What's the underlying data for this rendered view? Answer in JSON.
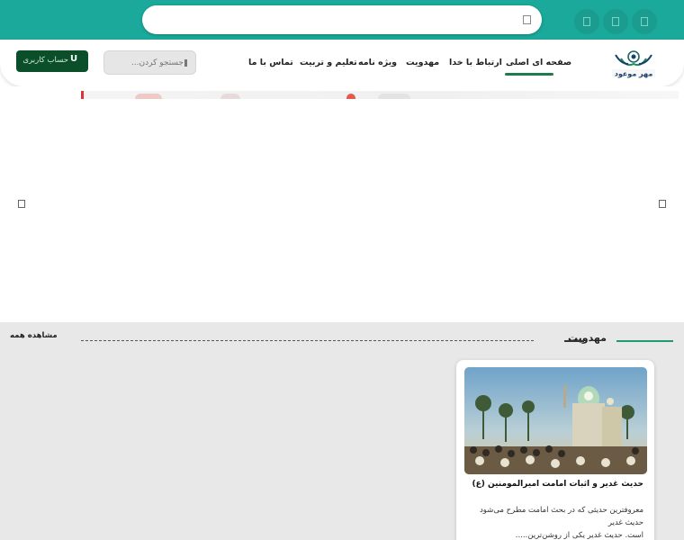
{
  "topbar": {
    "search": {
      "value": "",
      "placeholder": ""
    },
    "social_icons": [
      "square-icon",
      "square-icon",
      "square-icon"
    ],
    "color": "#1aa99a"
  },
  "header": {
    "logo_text": "مهر موعود",
    "nav": [
      {
        "label": "صفحه ای اصلی",
        "active": true
      },
      {
        "label": "ارتباط با خدا"
      },
      {
        "label": "مهدویت"
      },
      {
        "label": "ویژه نامه"
      },
      {
        "label": "تعلیم و تربیت"
      },
      {
        "label": "تماس با ما"
      }
    ],
    "search_placeholder": "جستجو کردن...",
    "account_label": "حساب کاربری",
    "account_icon": "user-icon",
    "accent": "#0b4f2a"
  },
  "slider": {
    "prev_icon": "square-icon",
    "next_icon": "square-icon"
  },
  "section": {
    "title": "مهدویت",
    "see_all": "مشاهده همه",
    "cards": [
      {
        "title": "حدیث غدیر و اثبات امامت امیرالمومنین (ع)",
        "excerpt_lines": [
          "معروفترین حدیثی که در بحث امامت مطرح می‌شود حدیث غدیر",
          "است. حدیث غدیر یکی از روشن‌ترین....."
        ]
      }
    ],
    "accent": "#1f9a6c"
  }
}
